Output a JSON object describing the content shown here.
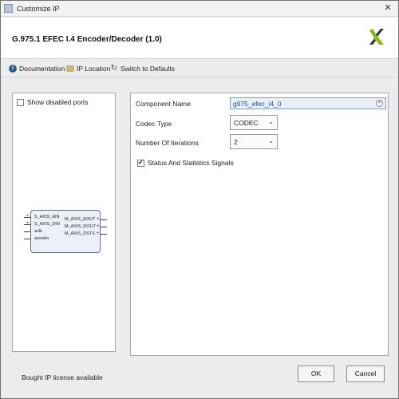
{
  "window": {
    "title": "Customize IP",
    "close_glyph": "✕"
  },
  "header": {
    "heading": "G.975.1 EFEC I.4 Encoder/Decoder (1.0)",
    "logo": "xilinx-logo"
  },
  "toolbar": {
    "documentation": "Documentation",
    "ip_location": "IP Location",
    "switch_defaults": "Switch to Defaults"
  },
  "left_panel": {
    "show_disabled_ports": "Show disabled ports",
    "show_disabled_checked": false,
    "block": {
      "left_ports": [
        "S_AXIS_EIN",
        "S_AXIS_DIN",
        "aclk",
        "aresetn"
      ],
      "right_ports": [
        "M_AXIS_EOUT",
        "M_AXIS_DOUT",
        "M_AXIS_DSTS"
      ]
    }
  },
  "form": {
    "component_name_label": "Component Name",
    "component_name_value": "g975_efec_i4_0",
    "codec_type_label": "Codec Type",
    "codec_type_value": "CODEC",
    "iterations_label": "Number Of Iterations",
    "iterations_value": "2",
    "status_signals_label": "Status And Statistics Signals",
    "status_signals_checked": true
  },
  "footer": {
    "license_text": "Bought IP license available",
    "ok_label": "OK",
    "cancel_label": "Cancel"
  }
}
